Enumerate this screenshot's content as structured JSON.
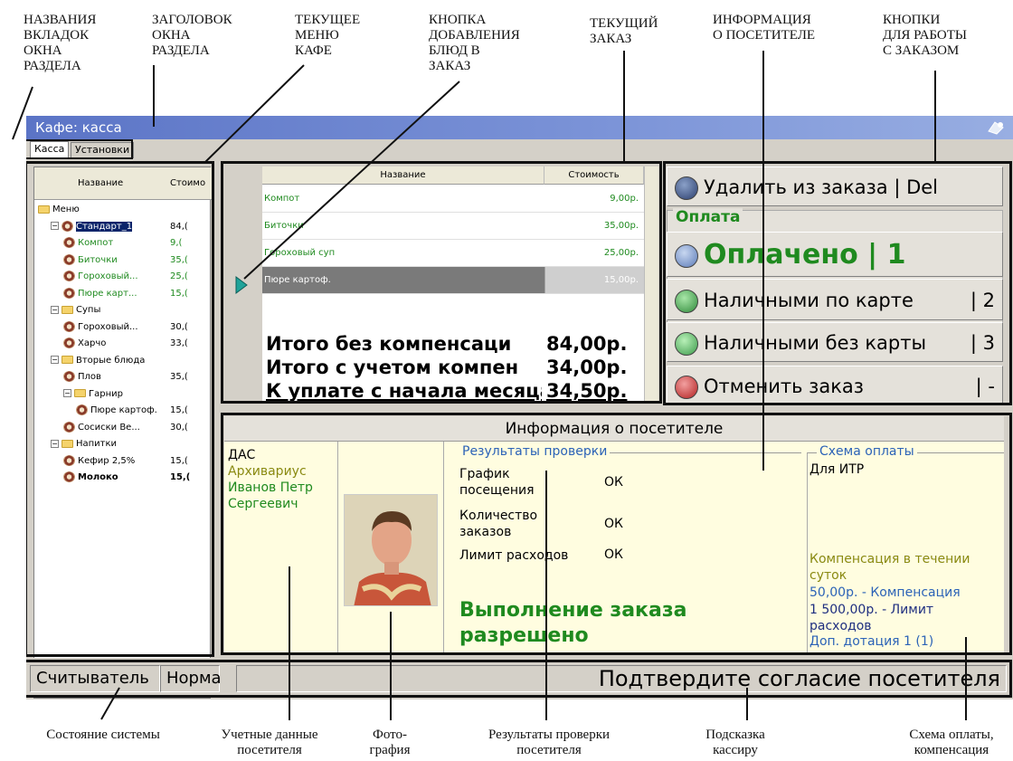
{
  "annotations_top": [
    "НАЗВАНИЯ\nВКЛАДОК\nОКНА\nРАЗДЕЛА",
    "ЗАГОЛОВОК\nОКНА\nРАЗДЕЛА",
    "ТЕКУЩЕЕ\nМЕНЮ\nКАФЕ",
    "КНОПКА\nДОБАВЛЕНИЯ\nБЛЮД В\nЗАКАЗ",
    "ТЕКУЩИЙ\nЗАКАЗ",
    "ИНФОРМАЦИЯ\nО ПОСЕТИТЕЛЕ",
    "КНОПКИ\nДЛЯ РАБОТЫ\nС ЗАКАЗОМ"
  ],
  "annotations_bottom": [
    "Состояние системы",
    "Учетные данные\nпосетителя",
    "Фото-\nграфия",
    "Результаты проверки\nпосетителя",
    "Подсказка\nкассиру",
    "Схема оплаты,\nкомпенсация"
  ],
  "window": {
    "title": "Кафе: касса",
    "tabs": [
      "Касса",
      "Установки"
    ]
  },
  "menu": {
    "header_name": "Название",
    "header_price": "Стоимо",
    "rows": [
      {
        "name": "Меню",
        "price": "",
        "icon": "folder-icon",
        "indent": 0,
        "exp": "",
        "color": ""
      },
      {
        "name": "Стандарт_1",
        "price": "84,(",
        "icon": "set-icon",
        "indent": 1,
        "exp": "−",
        "color": "sel"
      },
      {
        "name": "Компот",
        "price": "9,(",
        "icon": "dish-icon",
        "indent": 2,
        "exp": "",
        "color": "green"
      },
      {
        "name": "Биточки",
        "price": "35,(",
        "icon": "dish-icon",
        "indent": 2,
        "exp": "",
        "color": "green"
      },
      {
        "name": "Гороховый...",
        "price": "25,(",
        "icon": "dish-icon",
        "indent": 2,
        "exp": "",
        "color": "green"
      },
      {
        "name": "Пюре карт...",
        "price": "15,(",
        "icon": "dish-icon",
        "indent": 2,
        "exp": "",
        "color": "green"
      },
      {
        "name": "Супы",
        "price": "",
        "icon": "folder-icon",
        "indent": 1,
        "exp": "−",
        "color": ""
      },
      {
        "name": "Гороховый...",
        "price": "30,(",
        "icon": "dish-icon",
        "indent": 2,
        "exp": "",
        "color": ""
      },
      {
        "name": "Харчо",
        "price": "33,(",
        "icon": "dish-icon",
        "indent": 2,
        "exp": "",
        "color": ""
      },
      {
        "name": "Вторые блюда",
        "price": "",
        "icon": "folder-icon",
        "indent": 1,
        "exp": "−",
        "color": ""
      },
      {
        "name": "Плов",
        "price": "35,(",
        "icon": "dish-icon",
        "indent": 2,
        "exp": "",
        "color": ""
      },
      {
        "name": "Гарнир",
        "price": "",
        "icon": "folder-icon",
        "indent": 2,
        "exp": "−",
        "color": ""
      },
      {
        "name": "Пюре картоф.",
        "price": "15,(",
        "icon": "dish-icon",
        "indent": 3,
        "exp": "",
        "color": ""
      },
      {
        "name": "Сосиски Ве...",
        "price": "30,(",
        "icon": "dish-icon",
        "indent": 2,
        "exp": "",
        "color": ""
      },
      {
        "name": "Напитки",
        "price": "",
        "icon": "folder-icon",
        "indent": 1,
        "exp": "−",
        "color": ""
      },
      {
        "name": "Кефир 2,5%",
        "price": "15,(",
        "icon": "dish-icon",
        "indent": 2,
        "exp": "",
        "color": ""
      },
      {
        "name": "Молоко",
        "price": "15,(",
        "icon": "dish-icon",
        "indent": 2,
        "exp": "",
        "color": "bold"
      }
    ]
  },
  "order": {
    "header_name": "Название",
    "header_price": "Стоимость",
    "rows": [
      {
        "name": "Компот",
        "price": "9,00р."
      },
      {
        "name": "Биточки",
        "price": "35,00р."
      },
      {
        "name": "Гороховый суп",
        "price": "25,00р."
      },
      {
        "name": "Пюре картоф.",
        "price": "15,00р."
      }
    ],
    "totals": [
      {
        "label": "Итого без компенсаци",
        "value": "84,00р."
      },
      {
        "label": "Итого с учетом компен",
        "value": "34,00р."
      },
      {
        "label": "К уплате с начала месяца",
        "value": "34,50р."
      }
    ]
  },
  "actions": {
    "remove": "Удалить из заказа | Del",
    "payment_group": "Оплата",
    "paid": "Оплачено | 1",
    "cash_card": "Наличными по карте",
    "cash_card_key": "| 2",
    "cash_nocard": "Наличными без карты",
    "cash_nocard_key": "| 3",
    "cancel": "Отменить заказ",
    "cancel_key": "| -"
  },
  "visitor": {
    "title": "Информация о посетителе",
    "dept": "ДАС",
    "role": "Архивариус",
    "name": "Иванов Петр Сергеевич",
    "check_title": "Результаты проверки",
    "checks": [
      {
        "label": "График посещения",
        "value": "ОК"
      },
      {
        "label": "Количество заказов",
        "value": "ОК"
      },
      {
        "label": "Лимит расходов",
        "value": "ОК"
      }
    ],
    "verdict": "Выполнение заказа разрешено",
    "scheme_title": "Схема оплаты",
    "scheme_name": "Для ИТР",
    "scheme_comp": "Компенсация в течении суток",
    "scheme_lines": [
      "50,00р. - Компенсация",
      "1 500,00р. - Лимит расходов",
      "Доп. дотация 1 (1)"
    ]
  },
  "statusbar": {
    "reader": "Считыватель",
    "state": "Норма",
    "hint": "Подтвердите согласие посетителя"
  }
}
